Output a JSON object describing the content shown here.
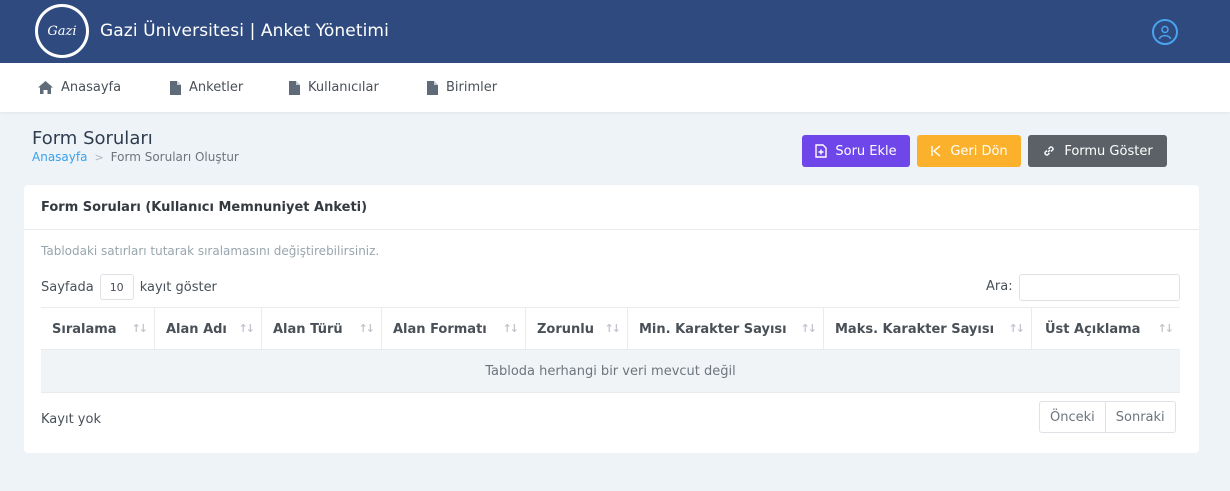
{
  "header": {
    "logo_text": "Gazi",
    "title": "Gazi Üniversitesi | Anket Yönetimi",
    "user_icon": "user-circle-icon"
  },
  "nav": {
    "items": [
      {
        "label": "Anasayfa",
        "icon": "home-icon"
      },
      {
        "label": "Anketler",
        "icon": "file-icon"
      },
      {
        "label": "Kullanıcılar",
        "icon": "file-icon"
      },
      {
        "label": "Birimler",
        "icon": "file-icon"
      }
    ]
  },
  "page": {
    "title": "Form Soruları",
    "breadcrumb": {
      "home": "Anasayfa",
      "separator": ">",
      "current": "Form Soruları Oluştur"
    }
  },
  "actions": {
    "add_label": "Soru Ekle",
    "back_label": "Geri Dön",
    "show_label": "Formu Göster",
    "colors": {
      "add": "#6e46ea",
      "back": "#fbb12b",
      "show": "#5b6167"
    }
  },
  "card": {
    "title": "Form Soruları (Kullanıcı Memnuniyet Anketi)",
    "hint": "Tablodaki satırları tutarak sıralamasını değiştirebilirsiniz.",
    "length": {
      "prefix": "Sayfada",
      "value": "10",
      "suffix": "kayıt göster"
    },
    "search_label": "Ara:",
    "columns": [
      "Sıralama",
      "Alan Adı",
      "Alan Türü",
      "Alan Formatı",
      "Zorunlu",
      "Min. Karakter Sayısı",
      "Maks. Karakter Sayısı",
      "Üst Açıklama"
    ],
    "empty_message": "Tabloda herhangi bir veri mevcut değil",
    "info": "Kayıt yok",
    "pager": {
      "prev": "Önceki",
      "next": "Sonraki"
    }
  },
  "theme": {
    "primary": "#2f4a7e",
    "link": "#38a1ec"
  }
}
